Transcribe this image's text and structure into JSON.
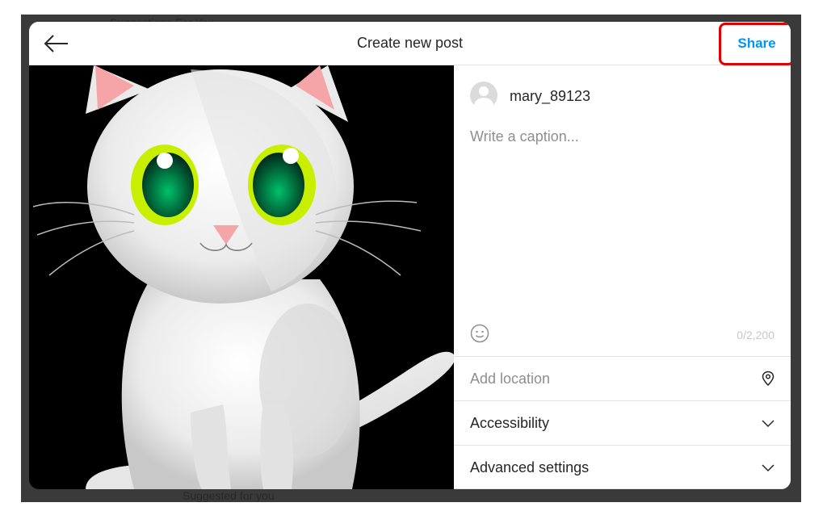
{
  "backdrop": {
    "top_text": "Suggestions For You",
    "bottom_text": "Suggested for you"
  },
  "modal": {
    "title": "Create new post",
    "share_label": "Share"
  },
  "compose": {
    "username": "mary_89123",
    "caption_placeholder": "Write a caption...",
    "char_count": "0/2,200"
  },
  "options": {
    "location_placeholder": "Add location",
    "accessibility_label": "Accessibility",
    "advanced_label": "Advanced settings"
  },
  "colors": {
    "accent": "#0095f6",
    "highlight": "#e00000"
  }
}
